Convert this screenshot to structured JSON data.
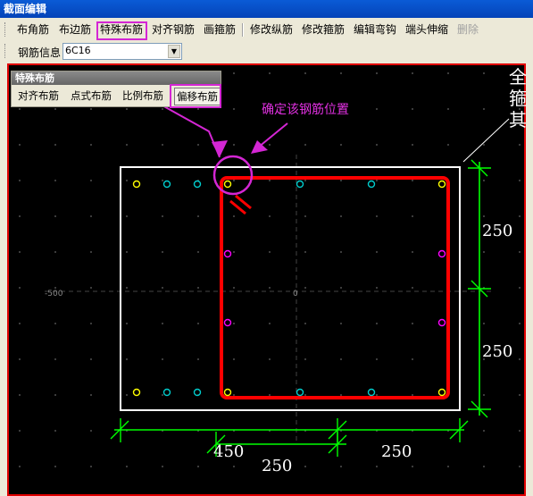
{
  "window": {
    "title": "截面编辑"
  },
  "toolbar": {
    "items": [
      "布角筋",
      "布边筋",
      "特殊布筋",
      "对齐钢筋",
      "画箍筋",
      "修改纵筋",
      "修改箍筋",
      "编辑弯钩",
      "端头伸缩",
      "删除"
    ],
    "disabled_item": "删除"
  },
  "rebar_info": {
    "label": "钢筋信息",
    "value": "6C16"
  },
  "special_panel": {
    "title": "特殊布筋",
    "items": [
      "对齐布筋",
      "点式布筋",
      "比例布筋",
      "偏移布筋"
    ],
    "selected": "偏移布筋"
  },
  "annotation": {
    "text": "确定该钢筋位置"
  },
  "canvas": {
    "dimensions": {
      "right_top": "250",
      "right_bottom": "250",
      "bottom_left": "450",
      "bottom_mid": "250",
      "bottom_right": "250"
    },
    "axis_labels": {
      "left": "-500",
      "center": "0"
    },
    "side_text": [
      "全",
      "箍",
      "其"
    ]
  },
  "colors": {
    "outer_section": "#ffffff",
    "stirrup": "#ff0000",
    "dimension": "#00ff00",
    "highlight": "#d426d4",
    "rebar_yellow": "#ffff00",
    "rebar_cyan": "#00cccc",
    "rebar_magenta": "#ff00ff"
  }
}
